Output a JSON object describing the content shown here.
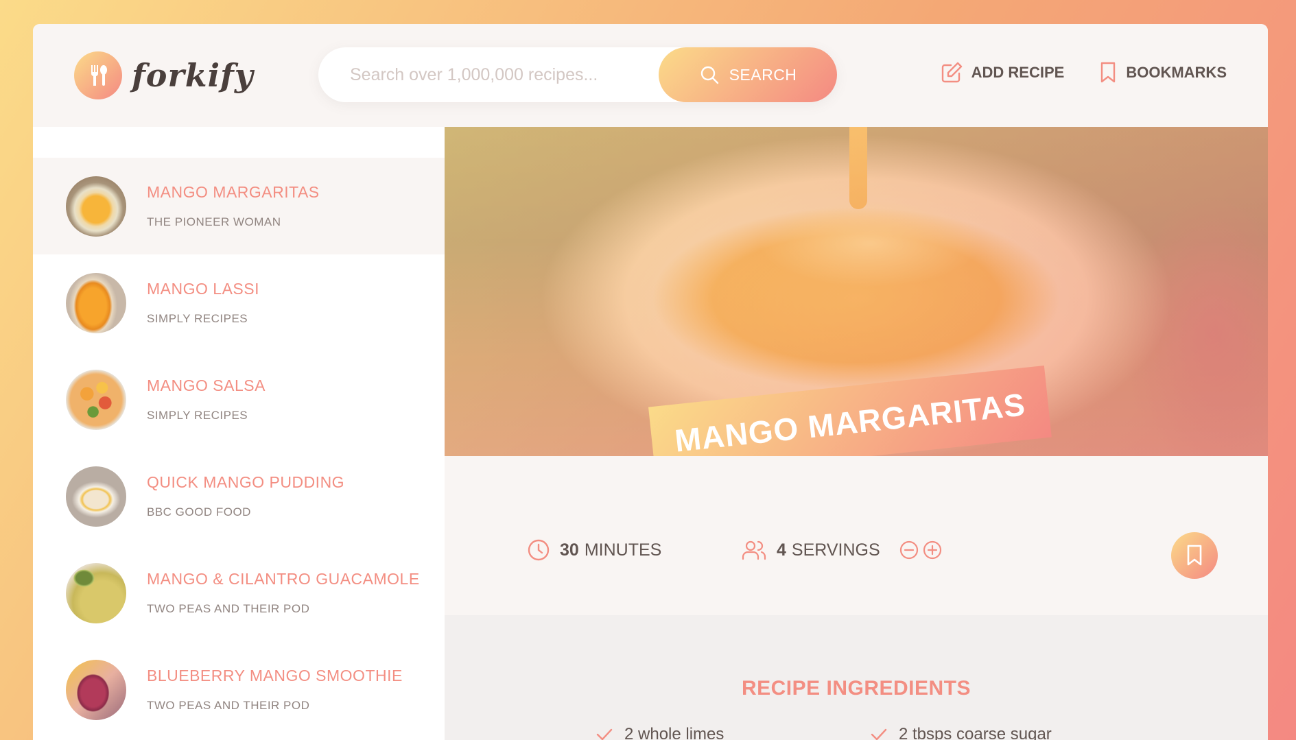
{
  "app": {
    "name": "forkify"
  },
  "search": {
    "placeholder": "Search over 1,000,000 recipes...",
    "button_label": "SEARCH"
  },
  "nav": {
    "add_recipe": "ADD RECIPE",
    "bookmarks": "BOOKMARKS"
  },
  "results": [
    {
      "title": "MANGO MARGARITAS",
      "publisher": "THE PIONEER WOMAN",
      "active": true
    },
    {
      "title": "MANGO LASSI",
      "publisher": "SIMPLY RECIPES",
      "active": false
    },
    {
      "title": "MANGO SALSA",
      "publisher": "SIMPLY RECIPES",
      "active": false
    },
    {
      "title": "QUICK MANGO PUDDING",
      "publisher": "BBC GOOD FOOD",
      "active": false
    },
    {
      "title": "MANGO & CILANTRO GUACAMOLE",
      "publisher": "TWO PEAS AND THEIR POD",
      "active": false
    },
    {
      "title": "BLUEBERRY MANGO SMOOTHIE",
      "publisher": "TWO PEAS AND THEIR POD",
      "active": false
    }
  ],
  "recipe": {
    "title": "MANGO MARGARITAS",
    "cooking_time": "30",
    "cooking_time_unit": "MINUTES",
    "servings": "4",
    "servings_unit": "SERVINGS",
    "ingredients_heading": "RECIPE INGREDIENTS",
    "ingredients": [
      "2 whole limes",
      "2 tbsps coarse sugar"
    ]
  },
  "colors": {
    "accent_start": "#fbdb89",
    "accent_end": "#f48982",
    "text": "#615551",
    "title": "#f38e82"
  }
}
